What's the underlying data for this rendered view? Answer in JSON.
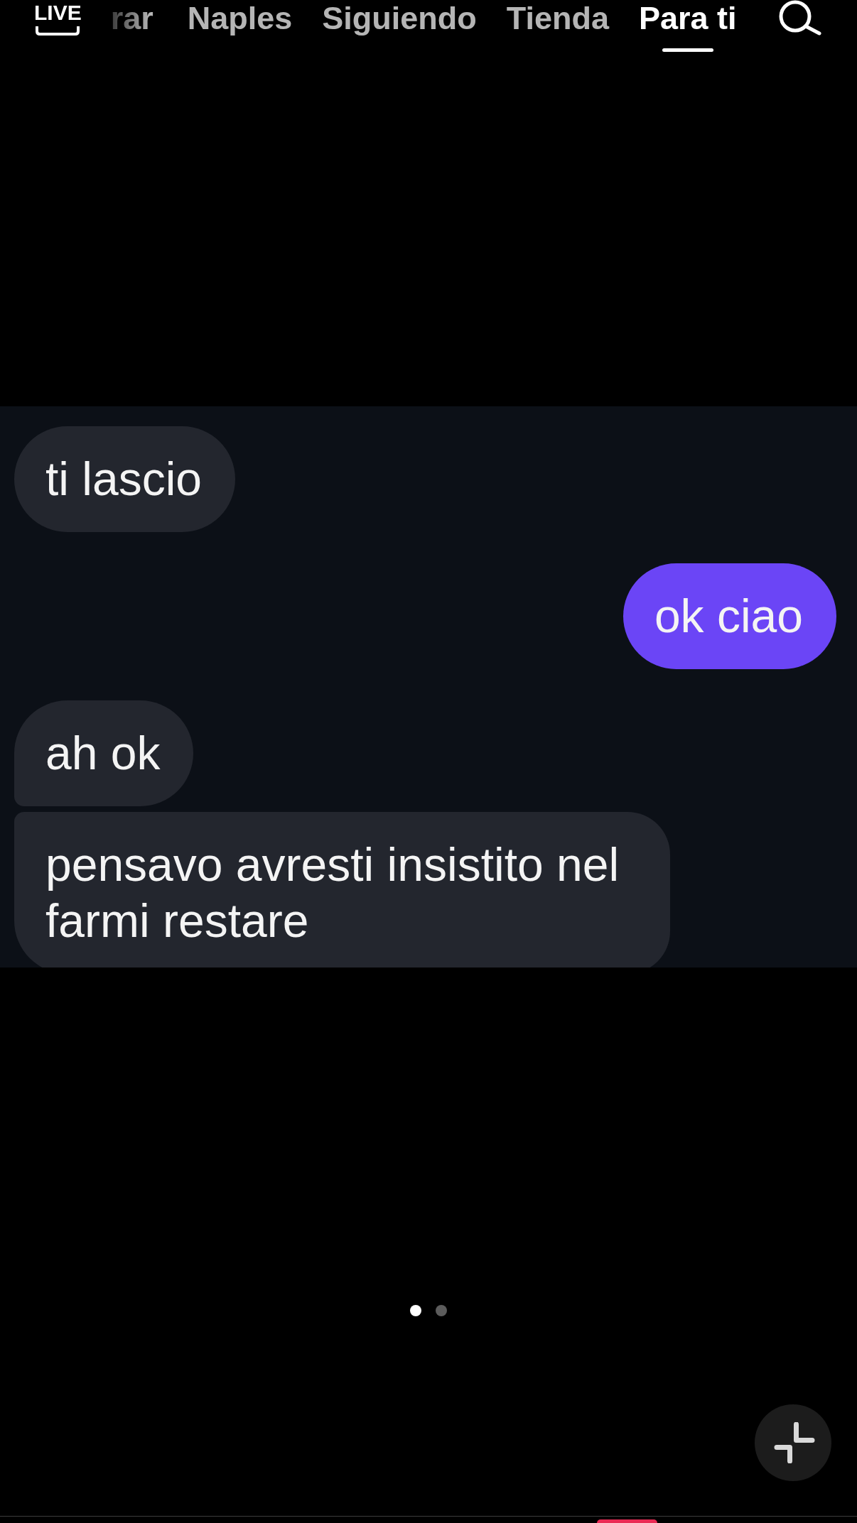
{
  "top_nav": {
    "live_label": "LIVE",
    "tabs": [
      {
        "label": "rar",
        "selected": false,
        "faded": true
      },
      {
        "label": "Naples",
        "selected": false,
        "faded": false
      },
      {
        "label": "Siguiendo",
        "selected": false,
        "faded": false
      },
      {
        "label": "Tienda",
        "selected": false,
        "faded": false
      },
      {
        "label": "Para ti",
        "selected": true,
        "faded": false
      }
    ]
  },
  "chat_screenshot": {
    "messages": [
      {
        "text": "ti lascio",
        "outgoing": false,
        "joined_above": false,
        "joined_below": false
      },
      {
        "text": "ok ciao",
        "outgoing": true,
        "joined_above": false,
        "joined_below": false
      },
      {
        "text": "ah ok",
        "outgoing": false,
        "joined_above": false,
        "joined_below": true
      },
      {
        "text": "pensavo avresti insistito nel farmi restare",
        "outgoing": false,
        "joined_above": true,
        "joined_below": false
      }
    ]
  },
  "page_dots": [
    {
      "selected": true
    },
    {
      "selected": false
    }
  ]
}
